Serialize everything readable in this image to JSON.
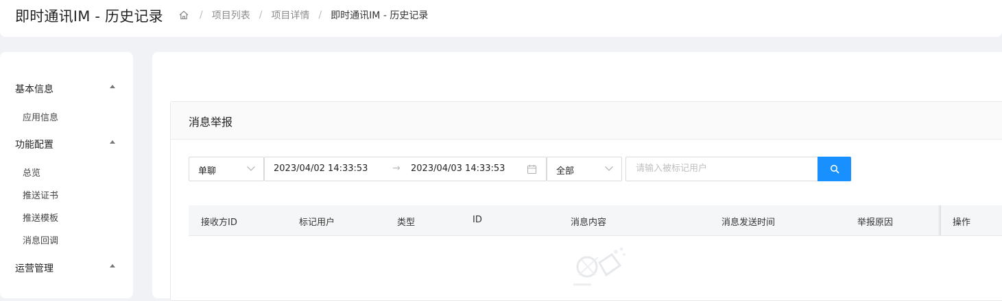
{
  "header": {
    "title": "即时通讯IM - 历史记录",
    "breadcrumb": [
      "项目列表",
      "项目详情",
      "即时通讯IM - 历史记录"
    ]
  },
  "sidebar": {
    "groups": [
      {
        "label": "基本信息",
        "items": [
          "应用信息"
        ]
      },
      {
        "label": "功能配置",
        "items": [
          "总览",
          "推送证书",
          "推送模板",
          "消息回调"
        ]
      },
      {
        "label": "运营管理",
        "items": []
      }
    ]
  },
  "card": {
    "title": "消息举报"
  },
  "filters": {
    "chat_type": "单聊",
    "date_start": "2023/04/02 14:33:53",
    "date_arrow": "→",
    "date_end": "2023/04/03 14:33:53",
    "status": "全部",
    "search_placeholder": "请输入被标记用户"
  },
  "table": {
    "columns": [
      "接收方ID",
      "标记用户",
      "类型",
      "ID",
      "消息内容",
      "消息发送时间",
      "举报原因",
      "操作"
    ]
  },
  "colors": {
    "accent": "#1890ff",
    "background": "#f0f2f5"
  },
  "icons": [
    "home-icon",
    "caret-up-icon",
    "chevron-down-icon",
    "calendar-icon",
    "search-icon",
    "empty-icon"
  ]
}
